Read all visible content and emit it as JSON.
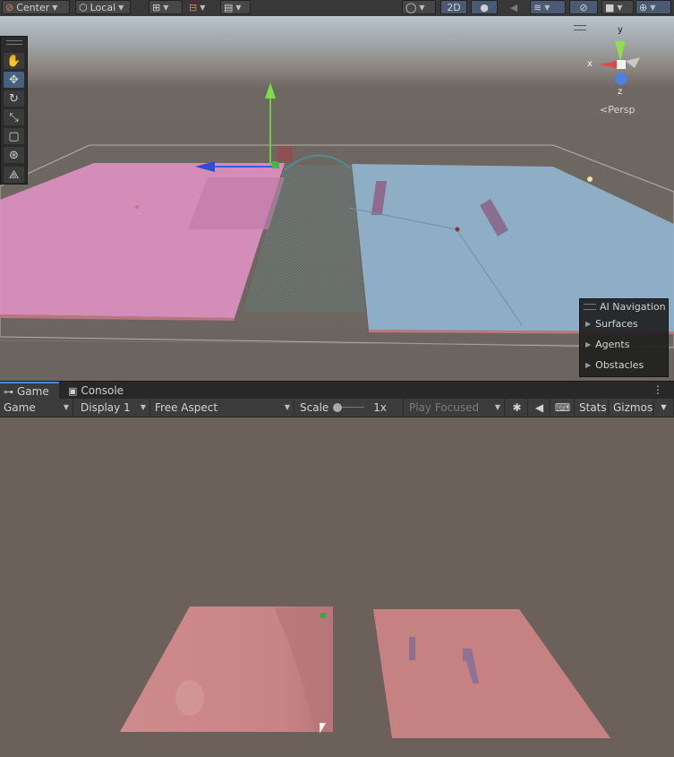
{
  "toolbar": {
    "pivot_label": "Center",
    "space_label": "Local",
    "view_2d_label": "2D"
  },
  "scene": {
    "persp_label": "Persp",
    "gizmo": {
      "x_label": "x",
      "y_label": "y",
      "z_label": "z"
    }
  },
  "ai_navigation": {
    "title": "AI Navigation",
    "items": [
      "Surfaces",
      "Agents",
      "Obstacles"
    ]
  },
  "tabs": {
    "game_label": "Game",
    "console_label": "Console"
  },
  "game_toolbar": {
    "mode": "Game",
    "display": "Display 1",
    "aspect": "Free Aspect",
    "scale_label": "Scale",
    "scale_value": "1x",
    "play_mode": "Play Focused",
    "stats_label": "Stats",
    "gizmos_label": "Gizmos"
  },
  "colors": {
    "accent": "#4b8bd1",
    "pink_surface": "#d88dbb",
    "blue_surface": "#8eb0c8",
    "game_floor": "#c98285"
  }
}
